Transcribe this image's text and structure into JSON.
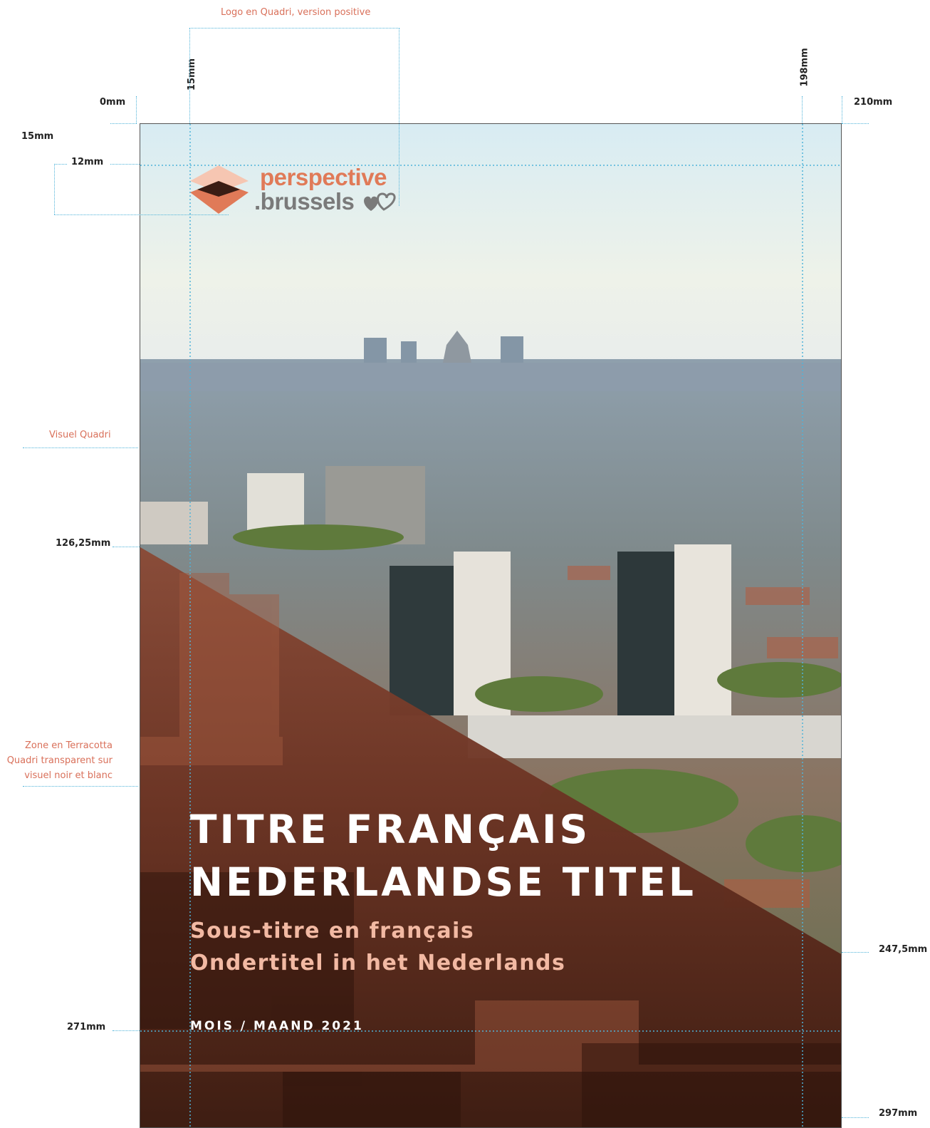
{
  "annotations": {
    "logo_note": "Logo en Quadri, version positive",
    "visual_note": "Visuel Quadri",
    "zone_note": [
      "Zone en Terracotta",
      "Quadri transparent sur",
      "visuel noir et blanc"
    ]
  },
  "dimensions": {
    "top_left": "0mm",
    "top_right": "210mm",
    "logo_left": "15mm",
    "logo_right": "198mm",
    "margin_top": "15mm",
    "logo_height": "12mm",
    "diagonal_start": "126,25mm",
    "diagonal_end": "247,5mm",
    "date_line": "271mm",
    "page_bottom": "297mm"
  },
  "logo": {
    "word1": "perspective",
    "word2": ".brussels"
  },
  "cover": {
    "title_fr": "TITRE FRANÇAIS",
    "title_nl": "NEDERLANDSE TITEL",
    "subtitle_fr": "Sous-titre en français",
    "subtitle_nl": "Ondertitel in het Nederlands",
    "date": "MOIS / MAAND 2021"
  },
  "colors": {
    "terracotta": "#d9705a",
    "logo_orange": "#e07a58",
    "logo_peach": "#f6c6b2",
    "logo_dark": "#3a1d14",
    "guide_blue": "#4fb3d9",
    "overlay": "#5a2518"
  }
}
